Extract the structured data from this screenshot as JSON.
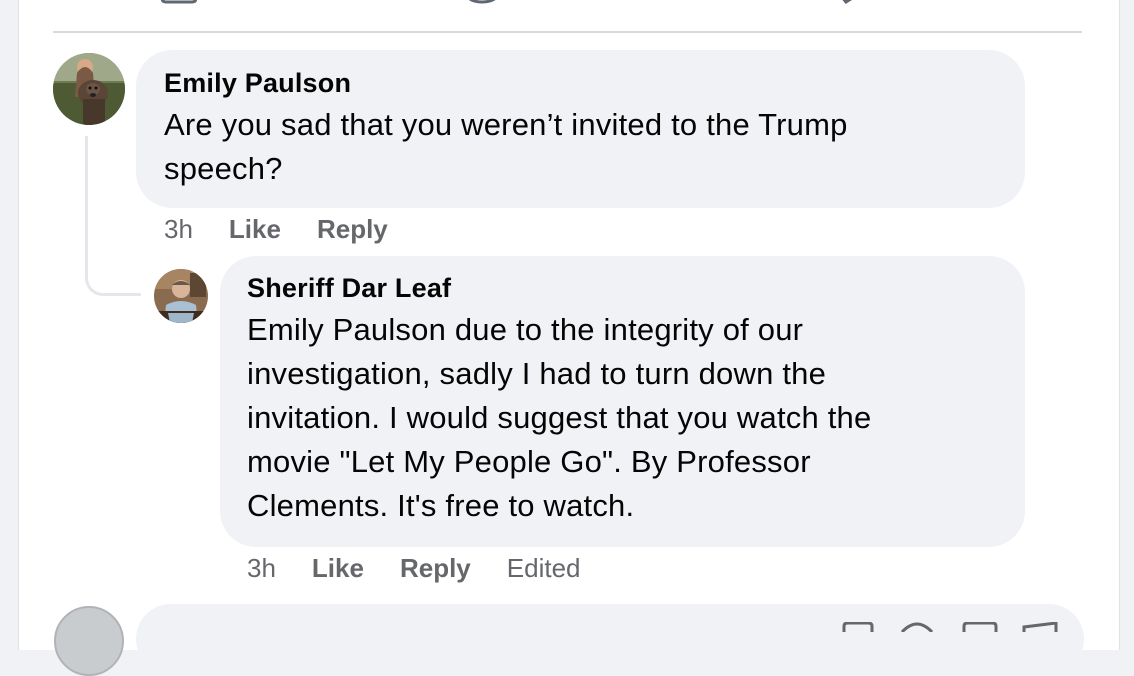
{
  "comments": [
    {
      "author": "Emily Paulson",
      "lines": [
        "Are you sad that you weren’t invited to the Trump",
        "speech?"
      ],
      "time": "3h",
      "like": "Like",
      "reply": "Reply",
      "avatar": "dog-photo-avatar"
    }
  ],
  "reply": {
    "author": "Sheriff Dar Leaf",
    "lines": [
      "Emily Paulson due to the integrity of our",
      "investigation, sadly I had to turn down the",
      "invitation. I would suggest that you watch the",
      "movie \"Let My People Go\". By Professor",
      "Clements. It's free to watch."
    ],
    "time": "3h",
    "like": "Like",
    "reply": "Reply",
    "edited": "Edited",
    "avatar": "man-photo-avatar"
  },
  "colors": {
    "bubble": "#f0f2f5",
    "meta_text": "#65676b",
    "primary_text": "#050505"
  },
  "icons": [
    "like-icon",
    "comment-icon",
    "share-icon",
    "sticker-icon",
    "emoji-icon",
    "camera-icon",
    "gif-icon"
  ]
}
